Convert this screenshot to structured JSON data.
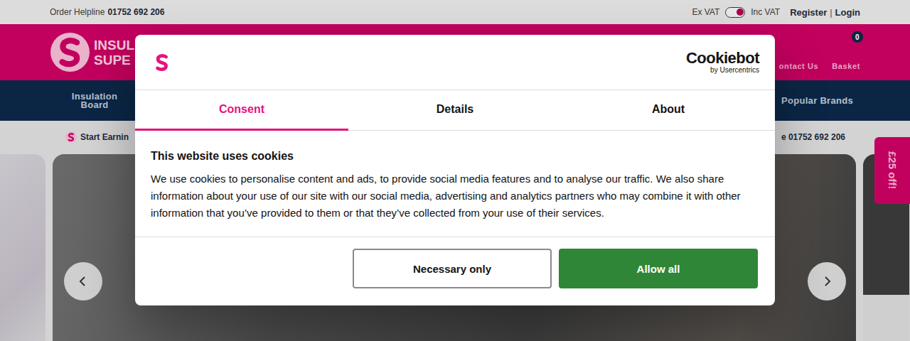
{
  "top_bar": {
    "helpline_label": "Order Helpline",
    "helpline_number": "01752 692 206",
    "vat_toggle": {
      "off_label": "Ex VAT",
      "on_label": "Inc VAT",
      "on": true
    },
    "register": "Register",
    "separator": "|",
    "login": "Login"
  },
  "header": {
    "logo_lines": [
      "INSUL",
      "SUPE"
    ],
    "links": [
      {
        "label": "ontact Us",
        "badge": ""
      },
      {
        "label": "Basket",
        "badge": "0"
      }
    ]
  },
  "nav": {
    "items": [
      "Insulation Board",
      "Popular Brands"
    ]
  },
  "promo_strip": {
    "left": "Start Earnin",
    "right": "e 01752 692 206"
  },
  "side_tab": {
    "label": "£25 off!"
  },
  "cookie_dialog": {
    "brand": "Cookiebot",
    "brand_sub": "by Usercentrics",
    "tabs": [
      {
        "label": "Consent",
        "selected": true
      },
      {
        "label": "Details",
        "selected": false
      },
      {
        "label": "About",
        "selected": false
      }
    ],
    "title": "This website uses cookies",
    "body": "We use cookies to personalise content and ads, to provide social media features and to analyse our traffic. We also share information about your use of our site with our social media, advertising and analytics partners who may combine it with other information that you’ve provided to them or that they’ve collected from your use of their services.",
    "buttons": [
      {
        "label": "Necessary only",
        "kind": "outline"
      },
      {
        "label": "Allow all",
        "kind": "primary"
      }
    ]
  }
}
